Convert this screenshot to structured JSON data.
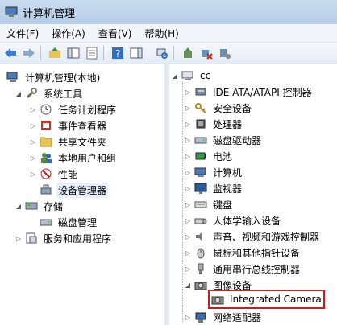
{
  "window": {
    "title": "计算机管理"
  },
  "menu": {
    "file": "文件(F)",
    "action": "操作(A)",
    "view": "查看(V)",
    "help": "帮助(H)"
  },
  "left_tree": {
    "root": "计算机管理(本地)",
    "system_tools": "系统工具",
    "task_scheduler": "任务计划程序",
    "event_viewer": "事件查看器",
    "shared_folders": "共享文件夹",
    "local_users": "本地用户和组",
    "performance": "性能",
    "device_manager": "设备管理器",
    "storage": "存储",
    "disk_management": "磁盘管理",
    "services_apps": "服务和应用程序"
  },
  "right_tree": {
    "computer_name": "cc",
    "items": [
      "IDE ATA/ATAPI 控制器",
      "安全设备",
      "处理器",
      "磁盘驱动器",
      "电池",
      "计算机",
      "监视器",
      "键盘",
      "人体学输入设备",
      "声音、视频和游戏控制器",
      "鼠标和其他指针设备",
      "通用串行总线控制器",
      "图像设备"
    ],
    "camera": "Integrated Camera",
    "network": "网络适配器"
  }
}
